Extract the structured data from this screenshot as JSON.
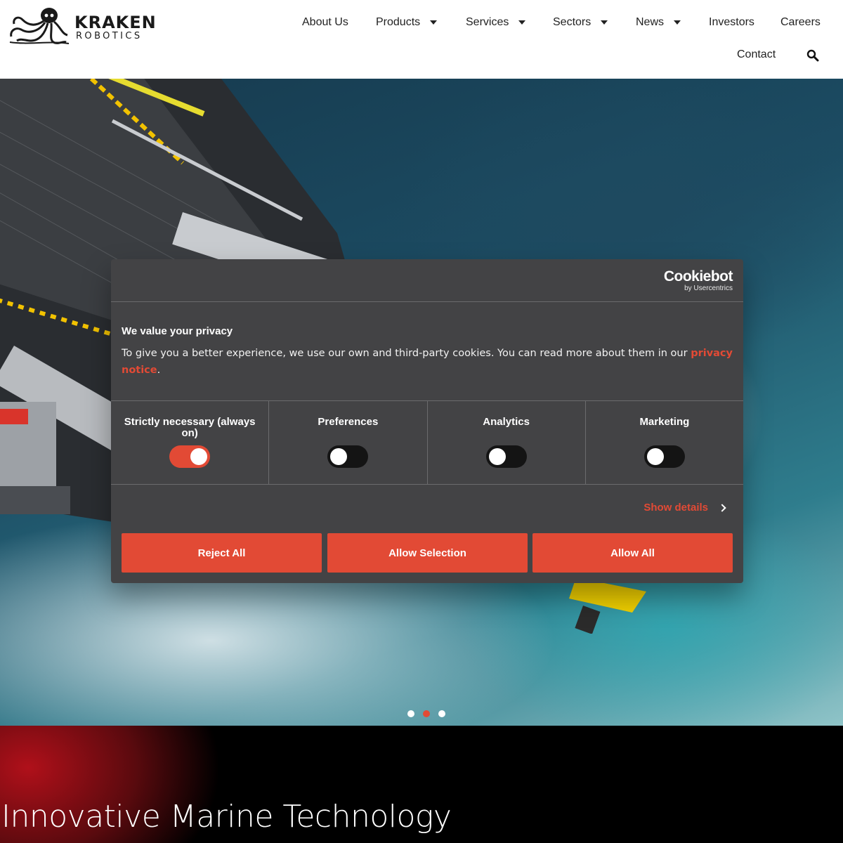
{
  "logo": {
    "line1": "KRAKEN",
    "line2": "ROBOTICS",
    "icon": "octopus-icon"
  },
  "nav": {
    "items": [
      {
        "label": "About Us"
      },
      {
        "label": "Products"
      },
      {
        "label": "Services"
      },
      {
        "label": "Sectors"
      },
      {
        "label": "News"
      },
      {
        "label": "Investors"
      },
      {
        "label": "Careers"
      },
      {
        "label": "Contact"
      }
    ],
    "search_icon": "search-icon"
  },
  "hero": {
    "slides_total": 3,
    "active_slide": 2
  },
  "band": {
    "title": "Innovative Marine Technology"
  },
  "cookie": {
    "brand": "Cookiebot",
    "brand_sub": "by Usercentrics",
    "title": "We value your privacy",
    "body": "To give you a better experience, we use our own and third-party cookies. You can read more about them in our ",
    "link": "privacy notice",
    "body_end": ".",
    "categories": [
      {
        "label": "Strictly necessary (always on)",
        "on": true
      },
      {
        "label": "Preferences",
        "on": false
      },
      {
        "label": "Analytics",
        "on": false
      },
      {
        "label": "Marketing",
        "on": false
      }
    ],
    "show_details": "Show details",
    "buttons": {
      "reject": "Reject All",
      "selection": "Allow Selection",
      "all": "Allow All"
    }
  },
  "colors": {
    "accent": "#e24a35",
    "dialog_bg": "#434345",
    "header_bg": "#ffffff"
  }
}
